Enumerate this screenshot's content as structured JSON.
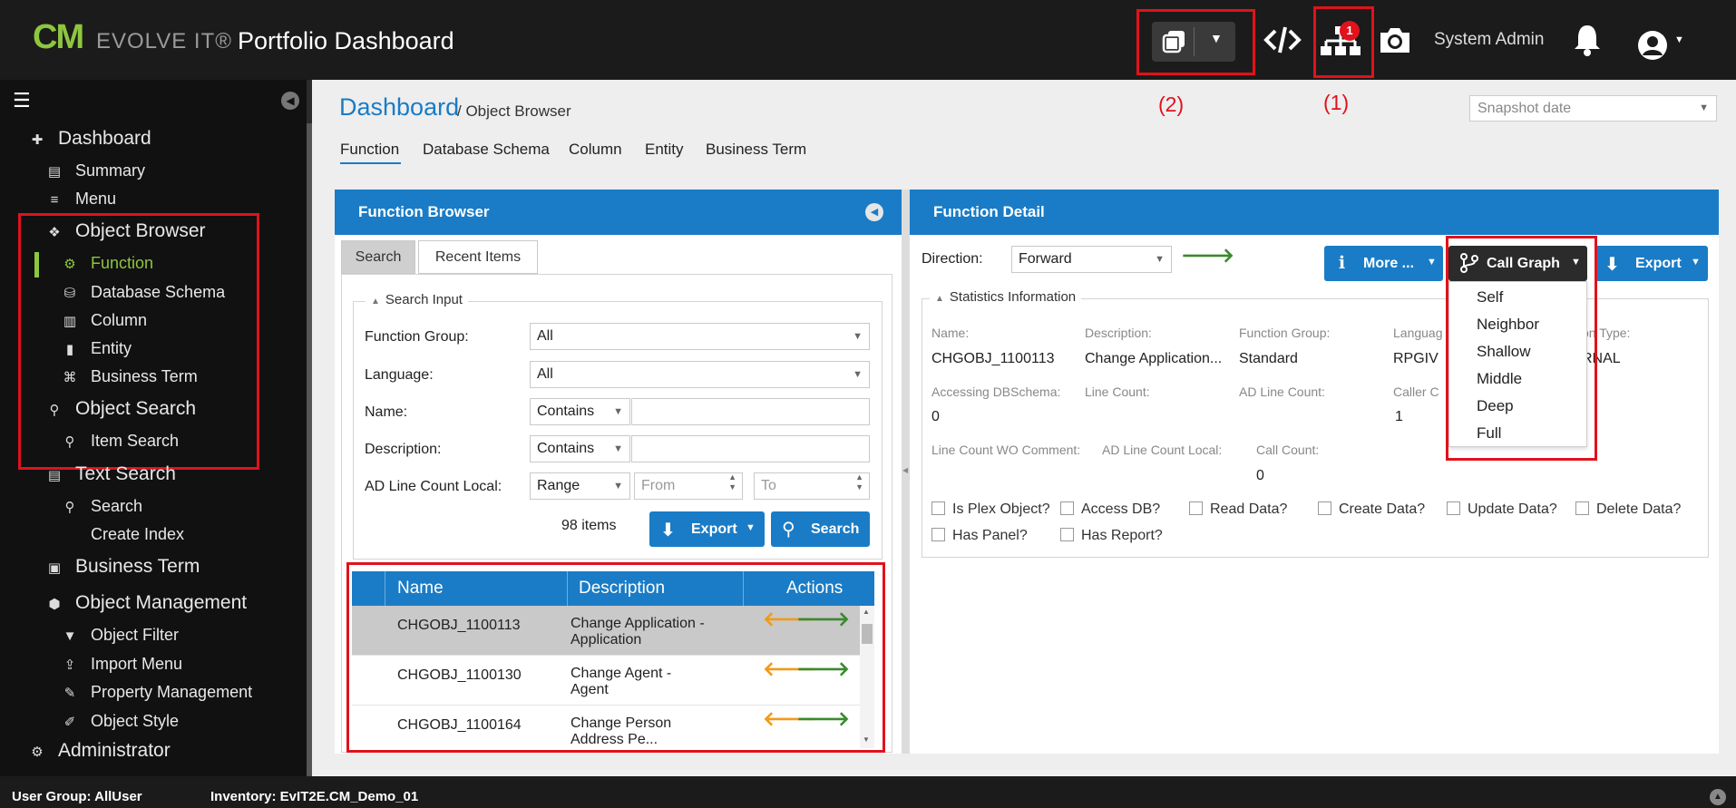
{
  "header": {
    "logo_cm": "CM",
    "logo_evolve": "EVOLVE IT®",
    "title": "Portfolio Dashboard",
    "user_name": "System Admin",
    "notification_badge": "1",
    "icons": [
      "windows-icon",
      "code-icon",
      "hierarchy-icon",
      "camera-icon",
      "bell-icon",
      "user-icon"
    ]
  },
  "annotations": {
    "label_2": "(2)",
    "label_1": "(1)"
  },
  "sidebar": {
    "dashboard": "Dashboard",
    "summary": "Summary",
    "menu": "Menu",
    "object_browser": "Object Browser",
    "function": "Function",
    "database_schema": "Database Schema",
    "column": "Column",
    "entity": "Entity",
    "business_term_sub": "Business Term",
    "object_search": "Object Search",
    "item_search": "Item Search",
    "text_search": "Text Search",
    "search": "Search",
    "create_index": "Create Index",
    "business_term": "Business Term",
    "object_management": "Object Management",
    "object_filter": "Object Filter",
    "import_menu": "Import Menu",
    "property_management": "Property Management",
    "object_style": "Object Style",
    "administrator": "Administrator"
  },
  "breadcrumb": {
    "root": "Dashboard",
    "sep": " / ",
    "current": "Object Browser"
  },
  "snapshot": {
    "placeholder": "Snapshot date"
  },
  "tabs": [
    "Function",
    "Database Schema",
    "Column",
    "Entity",
    "Business Term"
  ],
  "browser": {
    "title": "Function Browser",
    "tab_search": "Search",
    "tab_recent": "Recent Items",
    "search_input_legend": "Search Input",
    "function_group_label": "Function Group:",
    "function_group_value": "All",
    "language_label": "Language:",
    "language_value": "All",
    "name_label": "Name:",
    "name_op": "Contains",
    "description_label": "Description:",
    "description_op": "Contains",
    "ad_line_label": "AD Line Count Local:",
    "ad_line_op": "Range",
    "from_placeholder": "From",
    "to_placeholder": "To",
    "item_count": "98 items",
    "export_label": "Export",
    "search_label": "Search",
    "columns": {
      "name": "Name",
      "description": "Description",
      "actions": "Actions"
    },
    "rows": [
      {
        "name": "CHGOBJ_1100113",
        "desc1": "Change Application -",
        "desc2": "Application"
      },
      {
        "name": "CHGOBJ_1100130",
        "desc1": "Change Agent -",
        "desc2": "Agent"
      },
      {
        "name": "CHGOBJ_1100164",
        "desc1": "Change Person",
        "desc2": "Address Pe..."
      }
    ]
  },
  "detail": {
    "title": "Function Detail",
    "direction_label": "Direction:",
    "direction_value": "Forward",
    "more_label": "More ...",
    "call_graph_label": "Call Graph",
    "export_label": "Export",
    "stats_legend": "Statistics Information",
    "stats": {
      "name_l": "Name:",
      "name_v": "CHGOBJ_1100113",
      "desc_l": "Description:",
      "desc_v": "Change Application...",
      "fg_l": "Function Group:",
      "fg_v": "Standard",
      "lang_l": "Languag",
      "lang_v": "RPGIV",
      "type_l": "on Type:",
      "type_v": "RNAL",
      "adb_l": "Accessing DBSchema:",
      "adb_v": "0",
      "lc_l": "Line Count:",
      "adlc_l": "AD Line Count:",
      "caller_l": "Caller C",
      "caller_v": "1",
      "lcwo_l": "Line Count WO Comment:",
      "adlcl_l": "AD Line Count Local:",
      "cc_l": "Call Count:",
      "cc_v": "0"
    },
    "checks": [
      "Is Plex Object?",
      "Access DB?",
      "Read Data?",
      "Create Data?",
      "Update Data?",
      "Delete Data?",
      "Has Panel?",
      "Has Report?"
    ],
    "call_graph_options": [
      "Self",
      "Neighbor",
      "Shallow",
      "Middle",
      "Deep",
      "Full"
    ]
  },
  "footer": {
    "user_group": "User Group: AllUser",
    "inventory": "Inventory: EvIT2E.CM_Demo_01"
  }
}
